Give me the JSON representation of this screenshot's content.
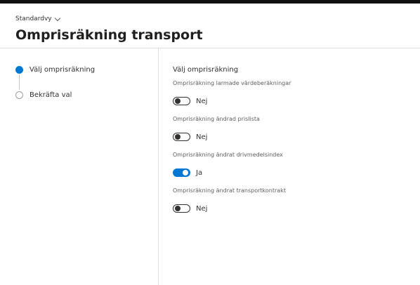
{
  "header": {
    "view_name": "Standardvy",
    "title": "Omprisräkning transport"
  },
  "steps": [
    {
      "label": "Välj omprisräkning",
      "state": "active"
    },
    {
      "label": "Bekräfta val",
      "state": "inactive"
    }
  ],
  "form": {
    "section_title": "Välj omprisräkning",
    "fields": [
      {
        "label": "Omprisräkning larmade värdeberäkningar",
        "on": false,
        "value_text": "Nej"
      },
      {
        "label": "Omprisräkning ändrad prislista",
        "on": false,
        "value_text": "Nej"
      },
      {
        "label": "Omprisräkning ändrat drivmedelsindex",
        "on": true,
        "value_text": "Ja"
      },
      {
        "label": "Omprisräkning ändrat transportkontrakt",
        "on": false,
        "value_text": "Nej"
      }
    ]
  },
  "colors": {
    "accent": "#0078d4",
    "toggle_off": "#323130",
    "divider": "#e1dfdd"
  }
}
